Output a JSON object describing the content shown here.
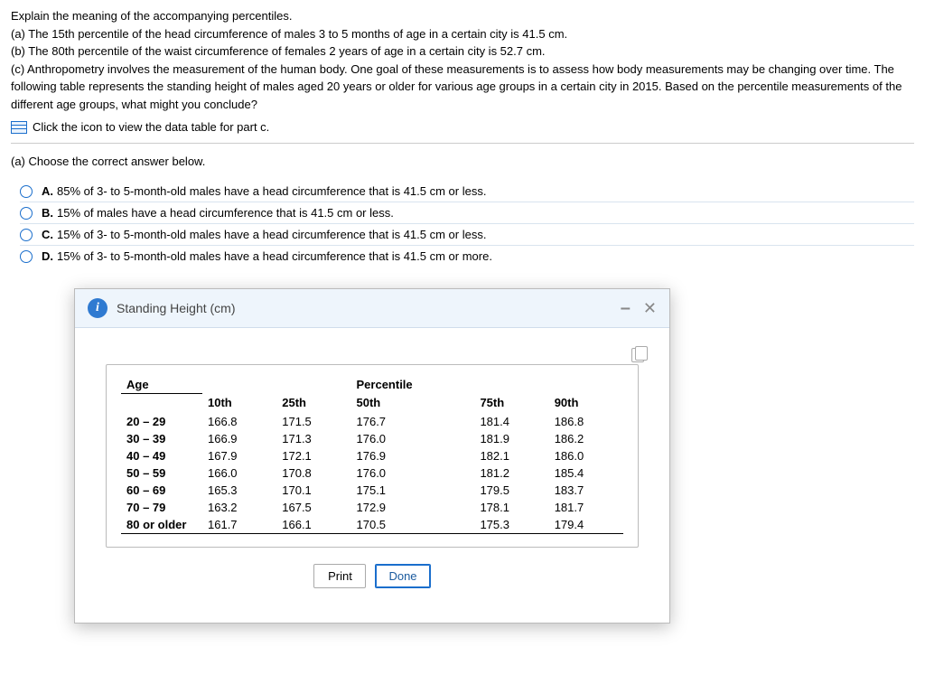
{
  "intro": {
    "prompt": "Explain the meaning of the accompanying percentiles.",
    "a": "(a) The 15th percentile of the head circumference of males 3 to 5 months of age in a certain city is 41.5 cm.",
    "b": "(b) The 80th percentile of the waist circumference of females 2 years of age in a certain city is 52.7 cm.",
    "c": "(c) Anthropometry involves the measurement of the human body. One goal of these measurements is to assess how body measurements may be changing over time. The following table represents the standing height of males aged 20 years or older for various age groups in a certain city in 2015. Based on the percentile measurements of the different age groups, what might you conclude?"
  },
  "click_hint": "Click the icon to view the data table for part c.",
  "sub_a": "(a) Choose the correct answer below.",
  "choices": {
    "A": {
      "letter": "A.",
      "text": "85% of 3- to 5-month-old males have a head circumference that is 41.5 cm or less."
    },
    "B": {
      "letter": "B.",
      "text": "15% of males have a head circumference that is 41.5 cm or less."
    },
    "C": {
      "letter": "C.",
      "text": "15% of 3- to 5-month-old males have a head circumference that is 41.5 cm or less."
    },
    "D": {
      "letter": "D.",
      "text": "15% of 3- to 5-month-old males have a head circumference that is 41.5 cm or more."
    }
  },
  "modal": {
    "title": "Standing Height (cm)",
    "age_header": "Age",
    "pct_header": "Percentile",
    "btn_print": "Print",
    "btn_done": "Done"
  },
  "chart_data": {
    "type": "table",
    "title": "Standing Height (cm)",
    "columns": [
      "10th",
      "25th",
      "50th",
      "75th",
      "90th"
    ],
    "rows": [
      {
        "age": "20 – 29",
        "v": [
          "166.8",
          "171.5",
          "176.7",
          "181.4",
          "186.8"
        ]
      },
      {
        "age": "30 – 39",
        "v": [
          "166.9",
          "171.3",
          "176.0",
          "181.9",
          "186.2"
        ]
      },
      {
        "age": "40 – 49",
        "v": [
          "167.9",
          "172.1",
          "176.9",
          "182.1",
          "186.0"
        ]
      },
      {
        "age": "50 – 59",
        "v": [
          "166.0",
          "170.8",
          "176.0",
          "181.2",
          "185.4"
        ]
      },
      {
        "age": "60 – 69",
        "v": [
          "165.3",
          "170.1",
          "175.1",
          "179.5",
          "183.7"
        ]
      },
      {
        "age": "70 – 79",
        "v": [
          "163.2",
          "167.5",
          "172.9",
          "178.1",
          "181.7"
        ]
      },
      {
        "age": "80 or older",
        "v": [
          "161.7",
          "166.1",
          "170.5",
          "175.3",
          "179.4"
        ]
      }
    ]
  }
}
